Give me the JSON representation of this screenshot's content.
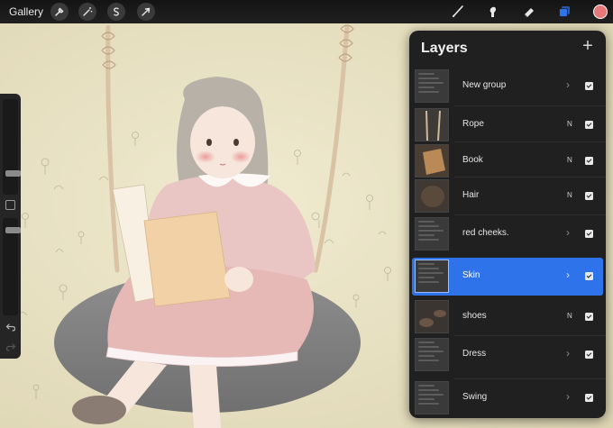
{
  "toolbar": {
    "gallery_label": "Gallery",
    "left_tools": [
      {
        "icon": "wrench-icon",
        "name": "actions-button"
      },
      {
        "icon": "magic-wand-icon",
        "name": "adjustments-button"
      },
      {
        "icon": "selection-s-icon",
        "name": "selection-button"
      },
      {
        "icon": "arrow-cursor-icon",
        "name": "transform-button"
      }
    ],
    "right_tools": [
      {
        "icon": "brush-icon",
        "name": "paint-button"
      },
      {
        "icon": "smudge-icon",
        "name": "smudge-button"
      },
      {
        "icon": "eraser-icon",
        "name": "eraser-button"
      },
      {
        "icon": "layers-icon",
        "name": "layers-button",
        "active": true
      }
    ],
    "current_color": "#e7787a",
    "accent_color": "#2f73ea"
  },
  "sidebar": {
    "brush_size_level": 0.2,
    "opacity_level": 0.6,
    "undo_icon": "undo-icon",
    "redo_icon": "redo-icon"
  },
  "layers_panel": {
    "title": "Layers",
    "add_icon": "plus-icon",
    "layers": [
      {
        "name": "New group",
        "mode": "",
        "kind": "group",
        "visible": true,
        "selected": false
      },
      {
        "name": "Rope",
        "mode": "N",
        "kind": "layer",
        "visible": true,
        "selected": false
      },
      {
        "name": "Book",
        "mode": "N",
        "kind": "layer",
        "visible": true,
        "selected": false
      },
      {
        "name": "Hair",
        "mode": "N",
        "kind": "layer",
        "visible": true,
        "selected": false
      },
      {
        "name": "red cheeks.",
        "mode": "",
        "kind": "group",
        "visible": true,
        "selected": false
      },
      {
        "name": "Skin",
        "mode": "",
        "kind": "group",
        "visible": true,
        "selected": true
      },
      {
        "name": "shoes",
        "mode": "N",
        "kind": "layer",
        "visible": true,
        "selected": false
      },
      {
        "name": "Dress",
        "mode": "",
        "kind": "group",
        "visible": true,
        "selected": false
      },
      {
        "name": "Swing",
        "mode": "",
        "kind": "group",
        "visible": true,
        "selected": false
      }
    ]
  }
}
